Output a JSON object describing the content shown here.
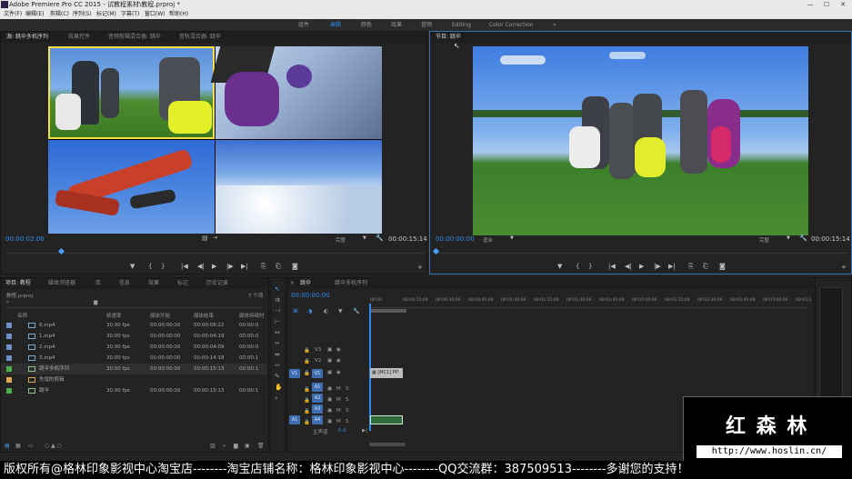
{
  "window": {
    "title": "Adobe Premiere Pro CC 2015 - 试教程素材\\教程.prproj *",
    "minimize": "—",
    "maximize": "☐",
    "close": "✕"
  },
  "menu": [
    "文件(F)",
    "编辑(E)",
    "剪辑(C)",
    "序列(S)",
    "标记(M)",
    "字幕(T)",
    "窗口(W)",
    "帮助(H)"
  ],
  "workspaces": {
    "items": [
      "组件",
      "编辑",
      "颜色",
      "效果",
      "音频",
      "Editing",
      "Color Correction"
    ],
    "more": "»"
  },
  "source_panel": {
    "tabs": [
      "源: 跳伞多机序列",
      "效果控件",
      "音频剪辑混合器: 跳伞",
      "音轨混合器: 跳伞"
    ],
    "timecode_left": "00:00:02:06",
    "quality": "完整",
    "timecode_right": "00:00:15:14"
  },
  "program_panel": {
    "tabs": [
      "节目: 跳伞"
    ],
    "timecode_left": "00:00:00:00",
    "fit": "适合",
    "quality": "完整",
    "timecode_right": "00:00:15:14"
  },
  "transport": [
    "▼",
    "{",
    "}",
    "|◀",
    "◀|",
    "▶",
    "|▶",
    "▶|",
    "⎘",
    "⎗",
    "◙"
  ],
  "add_button": "+",
  "project_panel": {
    "tabs": [
      "项目: 教程",
      "媒体浏览器",
      "库",
      "信息",
      "效果",
      "标记",
      "历史记录"
    ],
    "project_file": "教程.prproj",
    "item_count": "7 个项",
    "columns": [
      "名称",
      "帧速率",
      "媒体开始",
      "媒体结束",
      "媒体持续时"
    ],
    "rows": [
      {
        "name": "6.mp4",
        "fps": "30.00 fps",
        "start": "00:00:00:00",
        "end": "00:00:08:22",
        "dur": "00:00:0",
        "color": "#6d8fc8",
        "icon": "clip"
      },
      {
        "name": "1.mp4",
        "fps": "30.00 fps",
        "start": "00:00:00:00",
        "end": "00:00:04:19",
        "dur": "00:00:0",
        "color": "#6d8fc8",
        "icon": "clip"
      },
      {
        "name": "2.mp4",
        "fps": "30.00 fps",
        "start": "00:00:00:00",
        "end": "00:00:04:09",
        "dur": "00:00:0",
        "color": "#6d8fc8",
        "icon": "clip"
      },
      {
        "name": "3.mp4",
        "fps": "30.00 fps",
        "start": "00:00:00:00",
        "end": "00:00:14:18",
        "dur": "00:00:1",
        "color": "#6d8fc8",
        "icon": "clip"
      },
      {
        "name": "跳伞多机序列",
        "fps": "30.00 fps",
        "start": "00:00:00:00",
        "end": "00:00:15:13",
        "dur": "00:00:1",
        "color": "#4bb04b",
        "icon": "seq"
      },
      {
        "name": "先增的剪辑",
        "fps": "",
        "start": "",
        "end": "",
        "dur": "",
        "color": "#e0a94a",
        "icon": "bin"
      },
      {
        "name": "跳伞",
        "fps": "30.00 fps",
        "start": "00:00:00:00",
        "end": "00:00:15:13",
        "dur": "00:00:1",
        "color": "#4bb04b",
        "icon": "seq"
      }
    ]
  },
  "timeline_panel": {
    "tabs": [
      "跳伞",
      "跳伞多机序列"
    ],
    "timecode": "00:00:00:00",
    "ruler": [
      "00:00",
      "00:00:15:00",
      "00:00:30:00",
      "00:00:45:00",
      "00:01:00:00",
      "00:01:15:00",
      "00:01:30:00",
      "00:01:45:00",
      "00:02:00:00",
      "00:02:15:00",
      "00:02:30:00",
      "00:02:45:00",
      "00:03:00:00",
      "00:03:1"
    ],
    "video_tracks": [
      "V3",
      "V2",
      "V1"
    ],
    "audio_tracks": [
      "A1",
      "A2",
      "A3",
      "A4"
    ],
    "source_patch_v": "V1",
    "source_patch_a": "A1",
    "clip_label": "[MC1] PP",
    "master": "主声道",
    "master_value": "0.0",
    "m": "M",
    "s": "S"
  },
  "watermark": {
    "brand": "红 森 林",
    "url": "http://www.hoslin.cn/"
  },
  "bottom_band": "版权所有@格林印象影视中心淘宝店--------淘宝店铺名称：格林印象影视中心--------QQ交流群：387509513--------多谢您的支持！"
}
